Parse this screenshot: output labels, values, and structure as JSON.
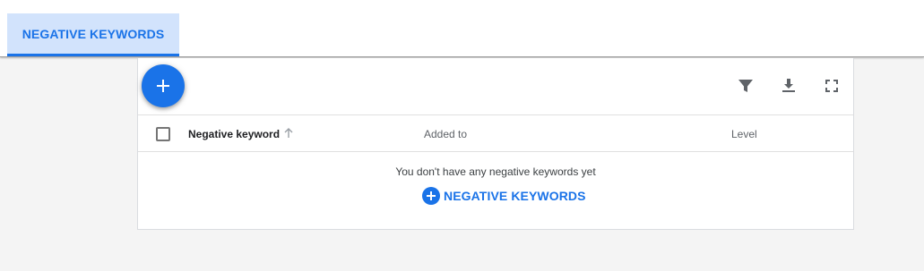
{
  "tabs": [
    {
      "label": "NEGATIVE KEYWORDS",
      "active": true
    }
  ],
  "toolbar": {
    "fab_icon": "plus-icon",
    "icons": [
      "filter-icon",
      "download-icon",
      "fullscreen-icon"
    ]
  },
  "table": {
    "columns": [
      "Negative keyword",
      "Added to",
      "Level"
    ],
    "sort_column": "Negative keyword",
    "sort_direction": "ascending",
    "rows": []
  },
  "empty_state": {
    "message": "You don't have any negative keywords yet",
    "action_label": "NEGATIVE KEYWORDS"
  },
  "colors": {
    "accent": "#1a73e8",
    "tab_bg": "#d2e3fc",
    "page_bg": "#f4f4f4"
  }
}
